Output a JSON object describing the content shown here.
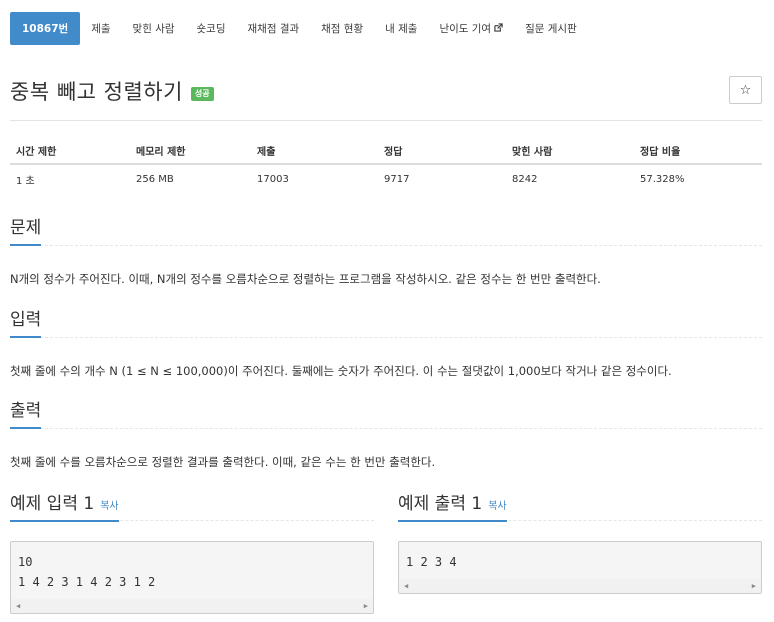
{
  "nav": [
    {
      "label": "10867번",
      "active": true
    },
    {
      "label": "제출"
    },
    {
      "label": "맞힌 사람"
    },
    {
      "label": "숏코딩"
    },
    {
      "label": "재채점 결과"
    },
    {
      "label": "채점 현황"
    },
    {
      "label": "내 제출"
    },
    {
      "label": "난이도 기여",
      "icon": "external-link-icon"
    },
    {
      "label": "질문 게시판"
    }
  ],
  "problem": {
    "title": "중복 빼고 정렬하기",
    "badge": "성공",
    "star": "☆"
  },
  "info": {
    "headers": [
      "시간 제한",
      "메모리 제한",
      "제출",
      "정답",
      "맞힌 사람",
      "정답 비율"
    ],
    "values": [
      "1 초",
      "256 MB",
      "17003",
      "9717",
      "8242",
      "57.328%"
    ]
  },
  "sections": {
    "description": {
      "title": "문제",
      "text": "N개의 정수가 주어진다. 이때, N개의 정수를 오름차순으로 정렬하는 프로그램을 작성하시오. 같은 정수는 한 번만 출력한다."
    },
    "input": {
      "title": "입력",
      "text": "첫째 줄에 수의 개수 N (1 ≤ N ≤ 100,000)이 주어진다. 둘째에는 숫자가 주어진다. 이 수는 절댓값이 1,000보다 작거나 같은 정수이다."
    },
    "output": {
      "title": "출력",
      "text": "첫째 줄에 수를 오름차순으로 정렬한 결과를 출력한다. 이때, 같은 수는 한 번만 출력한다."
    }
  },
  "samples": {
    "input": {
      "title": "예제 입력 1",
      "copy": "복사",
      "lines": [
        "10",
        "1 4 2 3 1 4 2 3 1 2"
      ]
    },
    "output": {
      "title": "예제 출력 1",
      "copy": "복사",
      "lines": [
        "1 2 3 4"
      ]
    }
  },
  "colors": {
    "accent": "#428bca",
    "success": "#5cb85c"
  }
}
